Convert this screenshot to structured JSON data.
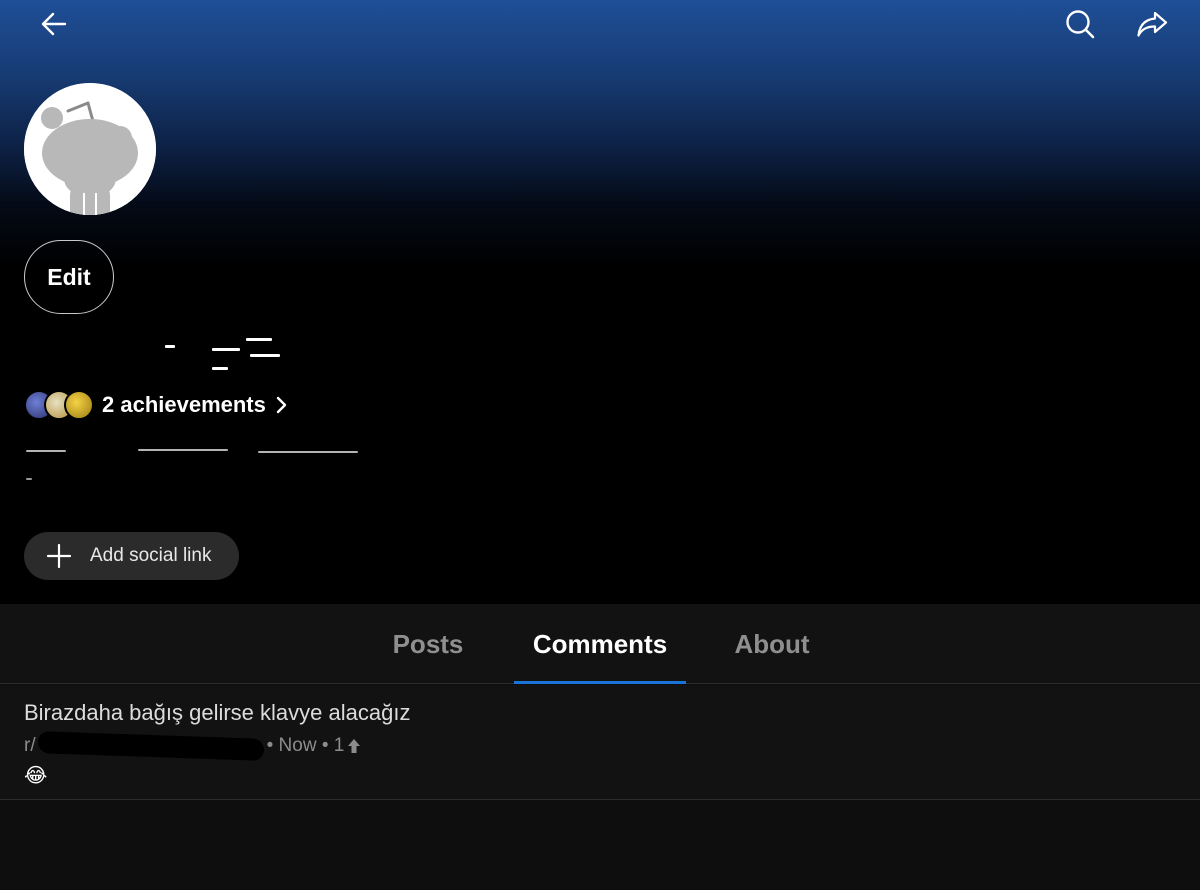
{
  "header": {
    "back_icon": "arrow-left-icon",
    "search_icon": "search-icon",
    "share_icon": "share-arrow-icon"
  },
  "profile": {
    "avatar": "snoo-avatar",
    "edit_label": "Edit",
    "achievements_label": "2 achievements",
    "add_social_link_label": "Add social link"
  },
  "tabs": [
    {
      "label": "Posts",
      "active": false
    },
    {
      "label": "Comments",
      "active": true
    },
    {
      "label": "About",
      "active": false
    }
  ],
  "comments": [
    {
      "title": "Birazdaha bağış gelirse klavye alacağız",
      "subreddit_prefix": "r/",
      "time": "• Now • 1",
      "emoji": "😂"
    }
  ],
  "colors": {
    "accent": "#1a73d9",
    "header_gradient_top": "#1f4f97",
    "background": "#0e0e0e"
  }
}
